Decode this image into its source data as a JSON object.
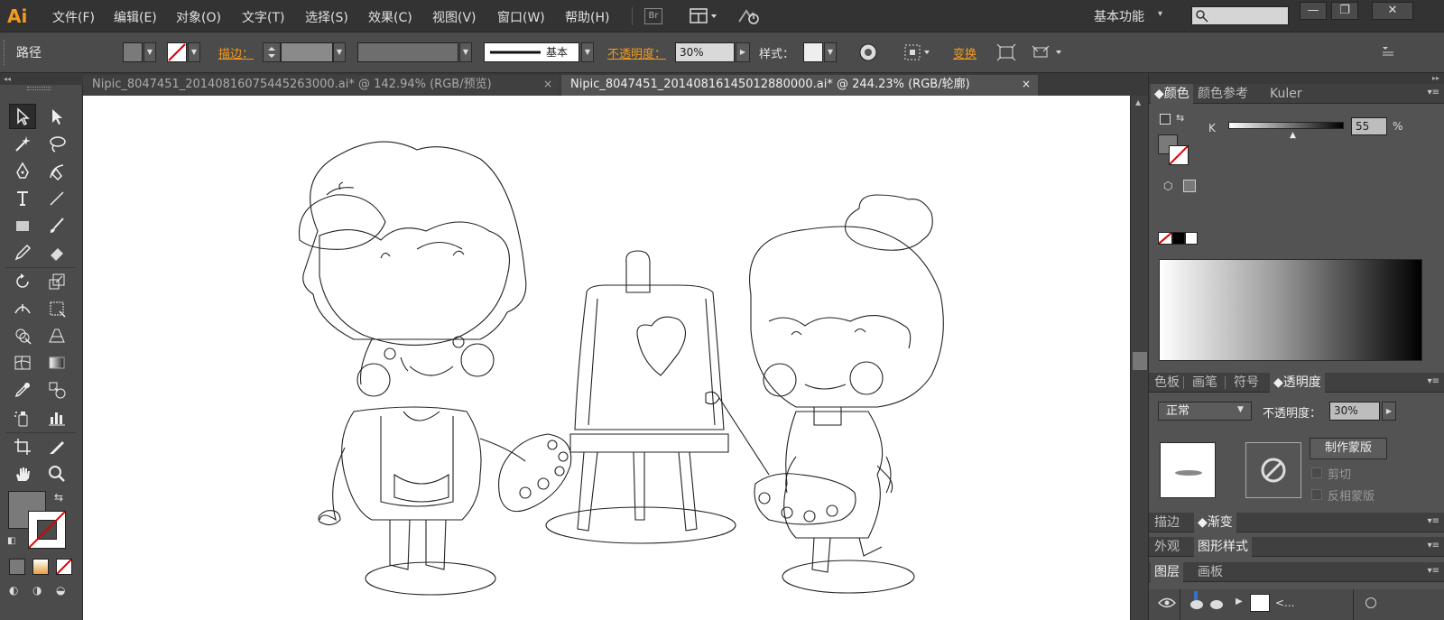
{
  "app": {
    "logo": "Ai"
  },
  "menu": [
    {
      "label": "文件(F)"
    },
    {
      "label": "编辑(E)"
    },
    {
      "label": "对象(O)"
    },
    {
      "label": "文字(T)"
    },
    {
      "label": "选择(S)"
    },
    {
      "label": "效果(C)"
    },
    {
      "label": "视图(V)"
    },
    {
      "label": "窗口(W)"
    },
    {
      "label": "帮助(H)"
    }
  ],
  "bridge_label": "Br",
  "workspace": {
    "label": "基本功能"
  },
  "search": {
    "placeholder": ""
  },
  "window_controls": {
    "minimize": "—",
    "restore": "❐",
    "close": "✕"
  },
  "control_bar": {
    "selection_label": "路径",
    "stroke_label": "描边：",
    "brush_label": "基本",
    "opacity_label": "不透明度：",
    "opacity_value": "30%",
    "style_label": "样式：",
    "transform_label": "变换"
  },
  "tabs": [
    {
      "title": "Nipic_8047451_20140816075445263000.ai* @ 142.94% (RGB/预览)",
      "close": "×"
    },
    {
      "title": "Nipic_8047451_20140816145012880000.ai* @ 244.23% (RGB/轮廓)",
      "close": "×"
    }
  ],
  "panels": {
    "color": {
      "tabs": [
        "颜色",
        "颜色参考",
        "Kuler"
      ],
      "k_label": "K",
      "k_value": "55",
      "k_unit": "%"
    },
    "transparency": {
      "tabs": [
        "色板",
        "画笔",
        "符号",
        "透明度"
      ],
      "blend_mode": "正常",
      "opacity_label": "不透明度：",
      "opacity_value": "30%",
      "make_mask": "制作蒙版",
      "clip": "剪切",
      "invert_mask": "反相蒙版"
    },
    "stroke_gradient": {
      "tabs": [
        "描边",
        "渐变"
      ]
    },
    "appearance": {
      "tabs": [
        "外观",
        "图形样式"
      ]
    },
    "layers": {
      "tabs": [
        "图层",
        "画板"
      ],
      "layer_name": "<..."
    }
  },
  "colors": {
    "fill": "#7a7a7a",
    "accent_orange": "#f39a1e",
    "artboard": "#ffffff"
  }
}
